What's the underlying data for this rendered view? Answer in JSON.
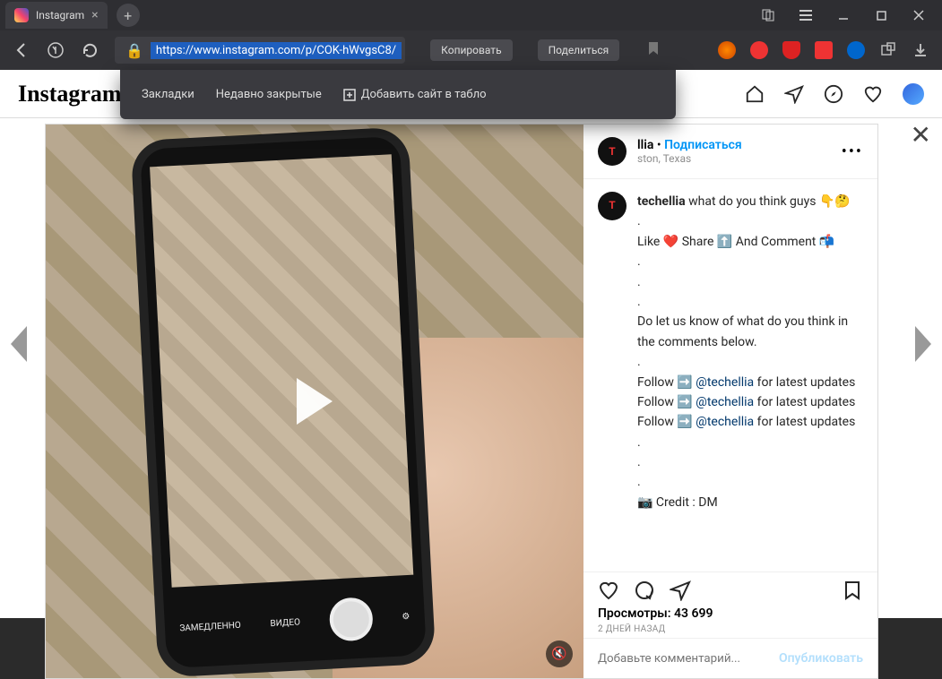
{
  "browser": {
    "tab_title": "Instagram",
    "url": "https://www.instagram.com/p/COK-hWvgsC8/",
    "copy_btn": "Копировать",
    "share_btn": "Поделиться"
  },
  "dropdown": {
    "bookmarks": "Закладки",
    "recently_closed": "Недавно закрытые",
    "add_site": "Добавить сайт в табло"
  },
  "instagram": {
    "logo": "Instagram"
  },
  "post": {
    "username": "techellia",
    "username_suffix": "llia",
    "separator": "•",
    "subscribe": "Подписаться",
    "location": "Houston, Texas",
    "location_suffix": "ston, Texas",
    "caption_text": "what do you think guys 👇🤔",
    "caption_line2": "Like ❤️ Share ⬆️ And Comment 📬",
    "caption_line3": "Do let us know of what do you think in the comments below.",
    "follow_prefix": "Follow ➡️ ",
    "mention": "@techellia",
    "follow_suffix": " for latest updates",
    "credit": "📷 Credit : DM",
    "views_label": "Просмотры: 43 699",
    "timestamp": "2 ДНЕЙ НАЗАД",
    "camera_modes": {
      "slow": "ЗАМЕДЛЕННО",
      "video": "ВИДЕО",
      "photo": "Ф"
    }
  },
  "comment": {
    "placeholder": "Добавьте комментарий...",
    "publish": "Опубликовать"
  }
}
